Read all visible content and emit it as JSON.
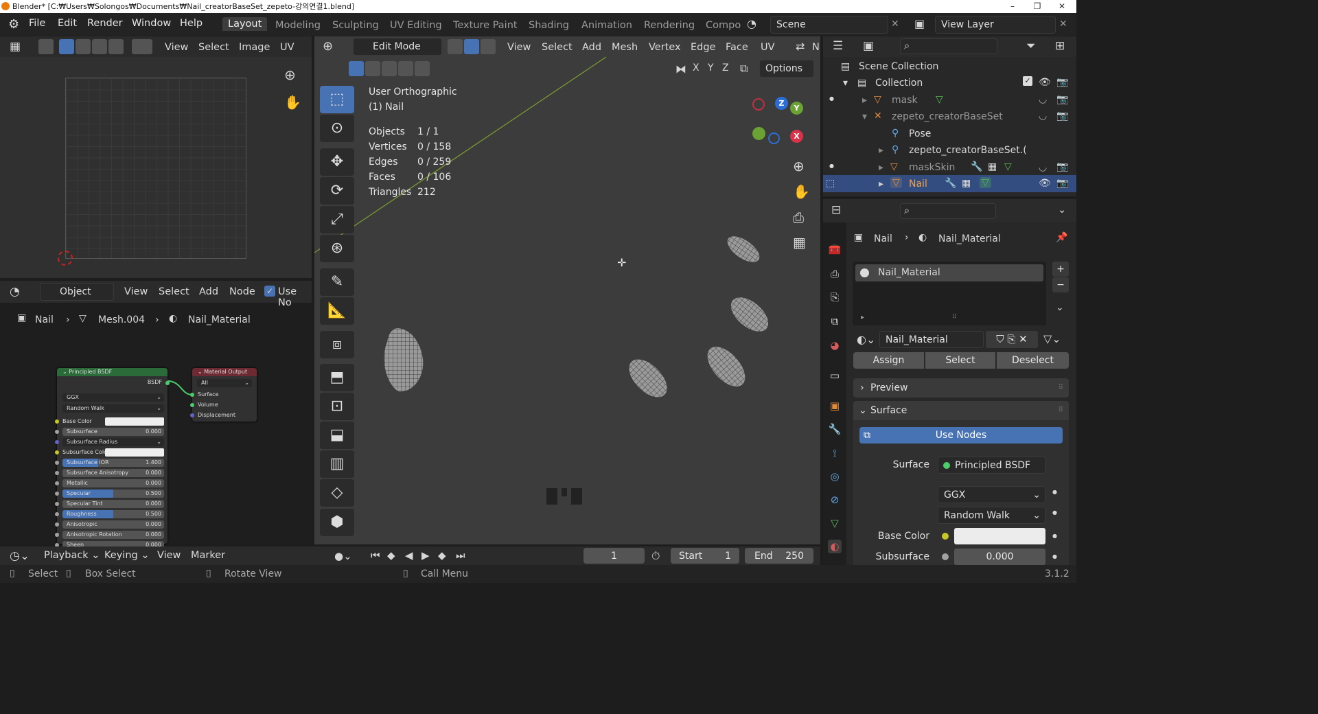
{
  "window": {
    "title": "Blender* [C:₩Users₩Solongos₩Documents₩Nail_creatorBaseSet_zepeto-강의연결1.blend]"
  },
  "menu": [
    "File",
    "Edit",
    "Render",
    "Window",
    "Help"
  ],
  "workspaces": [
    "Layout",
    "Modeling",
    "Sculpting",
    "UV Editing",
    "Texture Paint",
    "Shading",
    "Animation",
    "Rendering",
    "Compo"
  ],
  "scene": {
    "name": "Scene",
    "view_layer": "View Layer"
  },
  "uv_editor": {
    "menus": [
      "View",
      "Select",
      "Image",
      "UV"
    ]
  },
  "node_editor": {
    "object_mode": "Object",
    "menus": [
      "View",
      "Select",
      "Add",
      "Node"
    ],
    "use_nodes_label": "Use No",
    "breadcrumb": [
      "Nail",
      "Mesh.004",
      "Nail_Material"
    ]
  },
  "viewport": {
    "mode": "Edit Mode",
    "menus": [
      "View",
      "Select",
      "Add",
      "Mesh",
      "Vertex",
      "Edge",
      "Face",
      "UV"
    ],
    "menu_cut": "N",
    "view_name": "User Orthographic",
    "object_name": "(1) Nail",
    "options": "Options",
    "axes": [
      "X",
      "Y",
      "Z"
    ],
    "stats": [
      {
        "label": "Objects",
        "value": "1 / 1"
      },
      {
        "label": "Vertices",
        "value": "0 / 158"
      },
      {
        "label": "Edges",
        "value": "0 / 259"
      },
      {
        "label": "Faces",
        "value": "0 / 106"
      },
      {
        "label": "Triangles",
        "value": "212"
      }
    ]
  },
  "gizmo": {
    "z": "Z",
    "y": "Y",
    "x": "X"
  },
  "nodes": {
    "bsdf": {
      "title": "Principled BSDF",
      "out": "BSDF",
      "dist": "GGX",
      "sss": "Random Walk",
      "rows": [
        {
          "l": "Base Color",
          "v": ""
        },
        {
          "l": "Subsurface",
          "v": "0.000"
        },
        {
          "l": "Subsurface Radius",
          "v": ""
        },
        {
          "l": "Subsurface Color",
          "v": ""
        },
        {
          "l": "Subsurface IOR",
          "v": "1.400"
        },
        {
          "l": "Subsurface Anisotropy",
          "v": "0.000"
        },
        {
          "l": "Metallic",
          "v": "0.000"
        },
        {
          "l": "Specular",
          "v": "0.500"
        },
        {
          "l": "Specular Tint",
          "v": "0.000"
        },
        {
          "l": "Roughness",
          "v": "0.500"
        },
        {
          "l": "Anisotropic",
          "v": "0.000"
        },
        {
          "l": "Anisotropic Rotation",
          "v": "0.000"
        },
        {
          "l": "Sheen",
          "v": "0.000"
        }
      ]
    },
    "output": {
      "title": "Material Output",
      "target": "All",
      "inputs": [
        "Surface",
        "Volume",
        "Displacement"
      ]
    }
  },
  "outliner": {
    "items": [
      {
        "label": "Scene Collection"
      },
      {
        "label": "Collection"
      },
      {
        "label": "mask"
      },
      {
        "label": "zepeto_creatorBaseSet"
      },
      {
        "label": "Pose"
      },
      {
        "label": "zepeto_creatorBaseSet.("
      },
      {
        "label": "maskSkin"
      },
      {
        "label": "Nail"
      }
    ]
  },
  "properties": {
    "breadcrumb": [
      "Nail",
      "Nail_Material"
    ],
    "slot": "Nail_Material",
    "material": "Nail_Material",
    "assign": "Assign",
    "select": "Select",
    "deselect": "Deselect",
    "preview": "Preview",
    "surface_panel": "Surface",
    "use_nodes": "Use Nodes",
    "surface_label": "Surface",
    "surface_value": "Principled BSDF",
    "dist": "GGX",
    "sss": "Random Walk",
    "base_color_label": "Base Color",
    "subsurface_label": "Subsurface",
    "subsurface_value": "0.000"
  },
  "timeline": {
    "menus": [
      "Playback",
      "Keying",
      "View",
      "Marker"
    ],
    "frame": "1",
    "start_label": "Start",
    "start": "1",
    "end_label": "End",
    "end": "250"
  },
  "status": {
    "select": "Select",
    "box_select": "Box Select",
    "rotate": "Rotate View",
    "call_menu": "Call Menu",
    "version": "3.1.2"
  },
  "colors": {
    "accent": "#4772b3",
    "node_green": "#2b6b3a",
    "node_red": "#6e2a32"
  }
}
